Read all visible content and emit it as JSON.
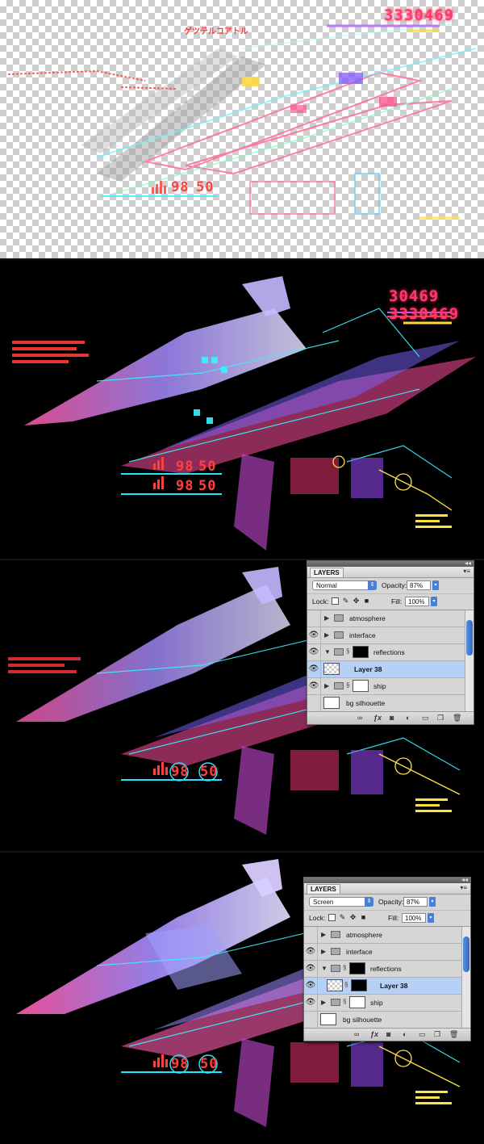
{
  "hud": {
    "score_partial": "30469",
    "score_full": "3330469",
    "timer_left": "98",
    "timer_right": "50",
    "katakana": "ゲツテルコアトル"
  },
  "layers_panels": [
    {
      "tab": "LAYERS",
      "blend_mode": "Normal",
      "opacity_label": "Opacity:",
      "opacity": "87%",
      "lock_label": "Lock:",
      "fill_label": "Fill:",
      "fill": "100%",
      "layers": [
        {
          "name": "atmosphere",
          "visible": false,
          "type": "group",
          "selected": false
        },
        {
          "name": "interface",
          "visible": true,
          "type": "group",
          "selected": false
        },
        {
          "name": "reflections",
          "visible": true,
          "type": "group-masked",
          "selected": false
        },
        {
          "name": "Layer 38",
          "visible": true,
          "type": "layer",
          "selected": true
        },
        {
          "name": "ship",
          "visible": true,
          "type": "group-masked",
          "selected": false
        },
        {
          "name": "bg silhouette",
          "visible": false,
          "type": "layer",
          "selected": false
        }
      ]
    },
    {
      "tab": "LAYERS",
      "blend_mode": "Screen",
      "opacity_label": "Opacity:",
      "opacity": "87%",
      "lock_label": "Lock:",
      "fill_label": "Fill:",
      "fill": "100%",
      "layers": [
        {
          "name": "atmosphere",
          "visible": false,
          "type": "group",
          "selected": false
        },
        {
          "name": "interface",
          "visible": true,
          "type": "group",
          "selected": false
        },
        {
          "name": "reflections",
          "visible": true,
          "type": "group-masked",
          "selected": false
        },
        {
          "name": "Layer 38",
          "visible": true,
          "type": "layer-masked",
          "selected": true
        },
        {
          "name": "ship",
          "visible": true,
          "type": "group-masked",
          "selected": false
        },
        {
          "name": "bg silhouette",
          "visible": false,
          "type": "layer",
          "selected": false
        }
      ]
    }
  ],
  "icons": {
    "eye": "eye-icon",
    "folder": "folder-icon",
    "disclosure": "disclosure-triangle-icon",
    "link": "link-icon",
    "lock": "lock-icon",
    "brush": "brush-icon",
    "move": "move-icon",
    "scroll": "scrollbar",
    "layer_link": "link-layers-icon",
    "fx": "fx-icon",
    "mask": "add-mask-icon",
    "adjust": "adjustment-layer-icon",
    "new_group": "new-group-icon",
    "new_layer": "new-layer-icon",
    "trash": "trash-icon"
  },
  "colors": {
    "selection": "#b7d0f5",
    "accent_blue": "#4a7fd4",
    "hud_red": "#ff3a6a",
    "hud_cyan": "#22e6ff",
    "hud_yellow": "#ffe24a",
    "ship_violet": "#a98cff",
    "ship_pink": "#ff4fa0"
  }
}
